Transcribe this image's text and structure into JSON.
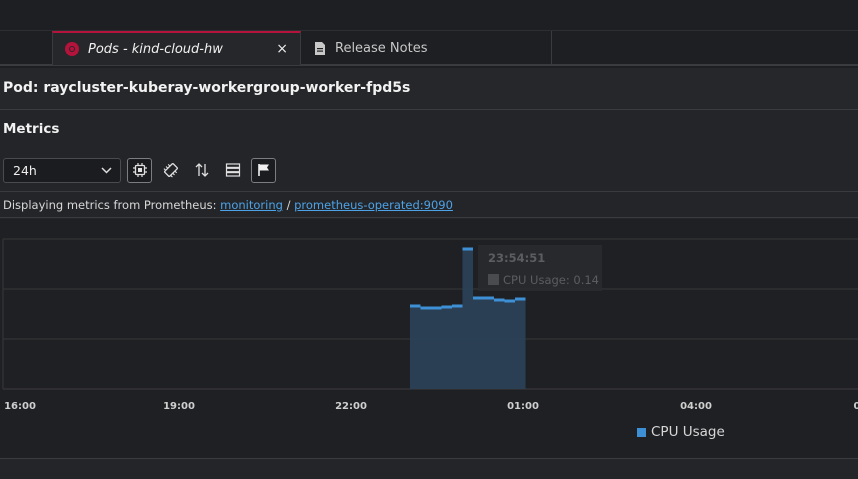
{
  "tabs": [
    {
      "label": "Pods - kind-cloud-hw",
      "close": "×"
    },
    {
      "label": "Release Notes"
    }
  ],
  "pod_title": "Pod: raycluster-kuberay-workergroup-worker-fpd5s",
  "metrics": {
    "title": "Metrics",
    "range_select": "24h",
    "source_prefix": "Displaying metrics from Prometheus: ",
    "source_namespace": "monitoring",
    "source_separator": " / ",
    "source_service": "prometheus-operated:9090",
    "controls": [
      "cpu-icon",
      "memory-icon",
      "network-icon",
      "filesystem-icon",
      "flag-icon"
    ]
  },
  "colors": {
    "accent": "#b5123c",
    "series": "#3d8fd6",
    "link": "#4da3e8"
  },
  "chart_data": {
    "type": "area",
    "series": [
      {
        "name": "CPU Usage",
        "values": [
          0.083,
          0.081,
          0.081,
          0.082,
          0.083,
          0.14,
          0.091,
          0.091,
          0.089,
          0.088,
          0.09
        ]
      }
    ],
    "x": [
      "23:10",
      "23:20",
      "23:30",
      "23:40",
      "23:50",
      "23:54:51",
      "00:00",
      "00:10",
      "00:20",
      "00:30",
      "00:40"
    ],
    "xticks": [
      "16:00",
      "19:00",
      "22:00",
      "01:00",
      "04:00",
      "0"
    ],
    "grid": true,
    "legend_position": "bottom-right",
    "tooltip": {
      "time": "23:54:51",
      "label": "CPU Usage: 0.14"
    }
  }
}
